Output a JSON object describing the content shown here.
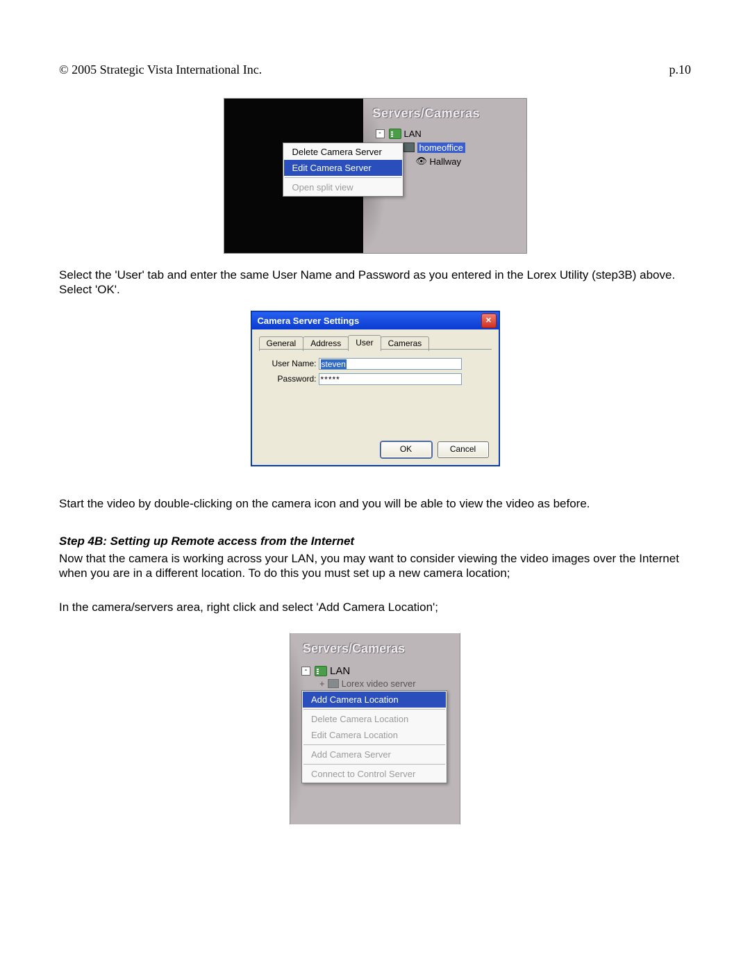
{
  "header": {
    "copyright": "© 2005 Strategic Vista International Inc.",
    "page_number": "p.10"
  },
  "screenshot1": {
    "panel_title": "Servers/Cameras",
    "tree": {
      "root": "LAN",
      "server": "homeoffice",
      "camera": "Hallway"
    },
    "context_menu": {
      "delete": "Delete Camera Server",
      "edit": "Edit Camera Server",
      "open_split": "Open split view"
    }
  },
  "para1": "Select the 'User' tab and enter the same User Name and Password as you entered in the Lorex Utility (step3B) above.  Select 'OK'.",
  "dialog": {
    "title": "Camera Server Settings",
    "tabs": {
      "general": "General",
      "address": "Address",
      "user": "User",
      "cameras": "Cameras"
    },
    "labels": {
      "username": "User Name:",
      "password": "Password:"
    },
    "values": {
      "username": "steven",
      "password": "*****"
    },
    "buttons": {
      "ok": "OK",
      "cancel": "Cancel"
    }
  },
  "para2": "Start the video by double-clicking on the camera icon and you will be able to view the video as before.",
  "step4b_heading": "Step 4B: Setting up Remote access from the Internet",
  "para3": "Now that the camera is working across your LAN, you may want to consider viewing the video images over the Internet when you are in a different location.  To do this you must set up a new camera location;",
  "para4": "In the camera/servers area, right click and select 'Add Camera Location';",
  "screenshot3": {
    "panel_title": "Servers/Cameras",
    "tree": {
      "root": "LAN",
      "server_partial": "Lorex video server"
    },
    "context_menu": {
      "add_loc": "Add Camera Location",
      "del_loc": "Delete Camera Location",
      "edit_loc": "Edit Camera Location",
      "add_srv": "Add Camera Server",
      "connect": "Connect to Control Server"
    }
  }
}
